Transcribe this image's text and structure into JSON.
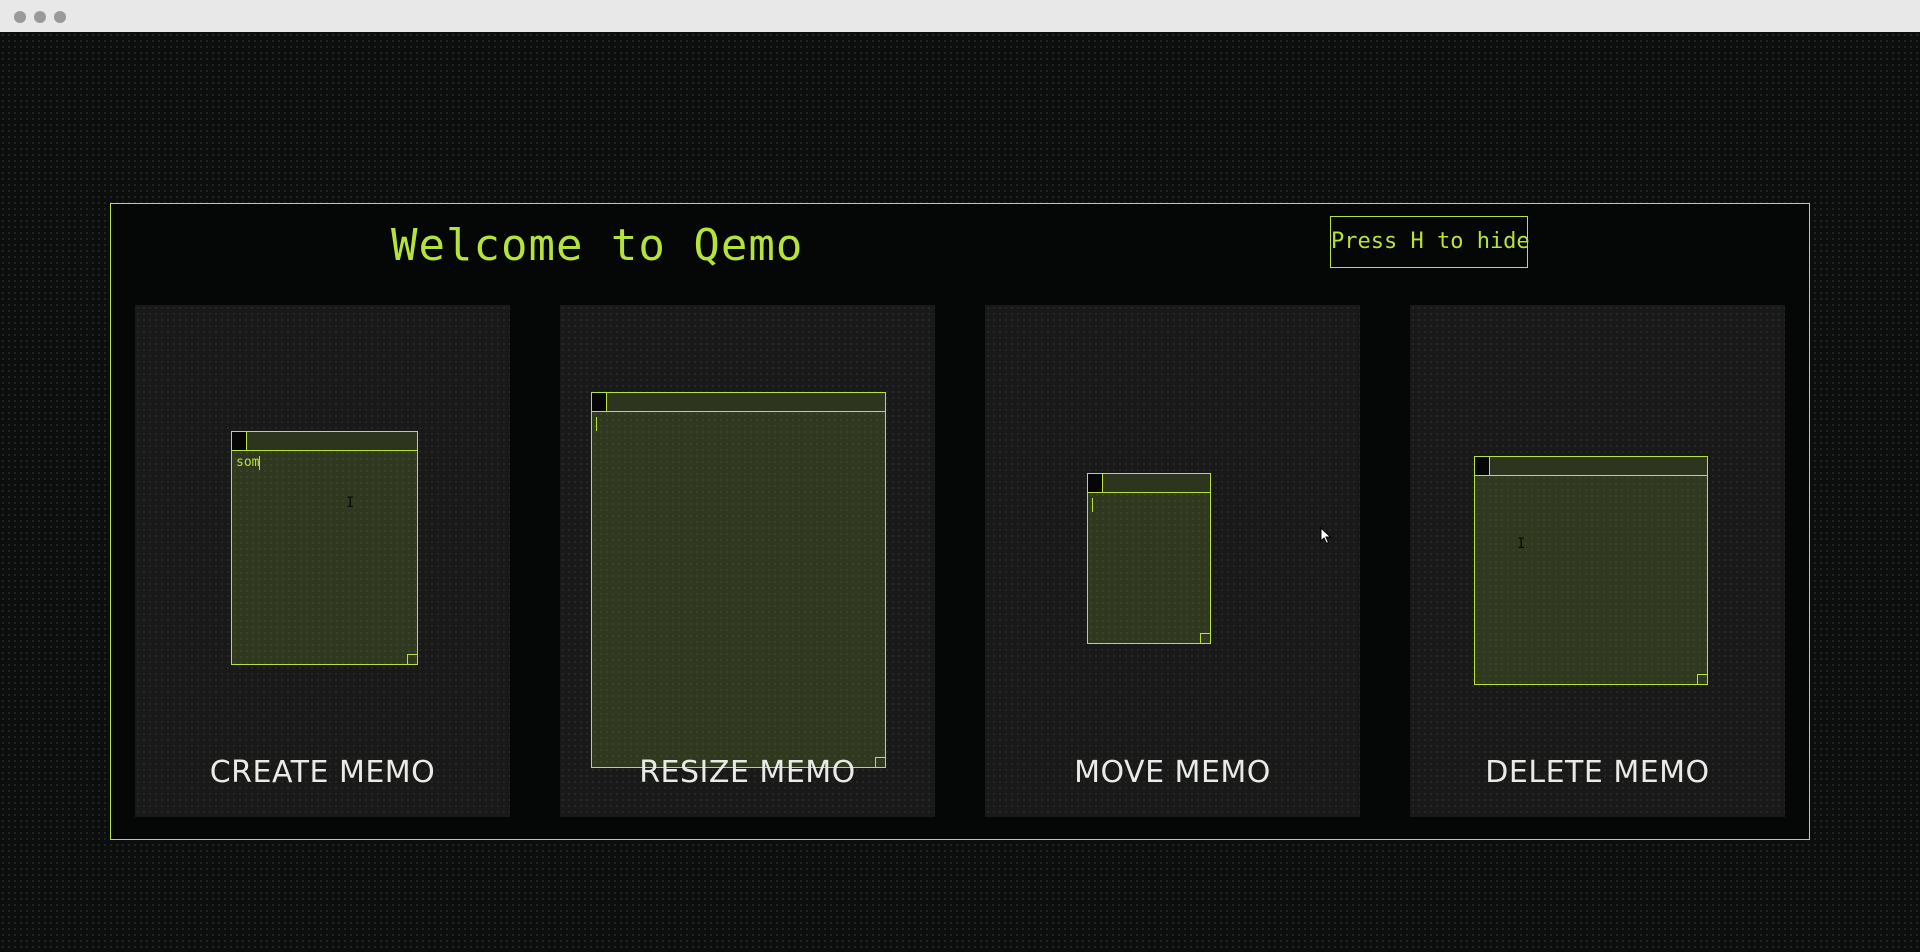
{
  "onboarding": {
    "title": "Welcome to Qemo",
    "hide_hint": "Press H to hide",
    "accent_color": "#b6e33a",
    "cards": [
      {
        "label": "CREATE MEMO",
        "memo_text": "som"
      },
      {
        "label": "RESIZE MEMO",
        "memo_text": ""
      },
      {
        "label": "MOVE MEMO",
        "memo_text": ""
      },
      {
        "label": "DELETE MEMO",
        "memo_text": ""
      }
    ]
  },
  "icons": {
    "window_controls": "traffic-light-dots",
    "memo_close": "square-close-icon",
    "memo_resize": "corner-resize-handle-icon",
    "text_cursor": "i-beam-cursor-icon",
    "mouse_cursor": "arrow-pointer-icon"
  }
}
